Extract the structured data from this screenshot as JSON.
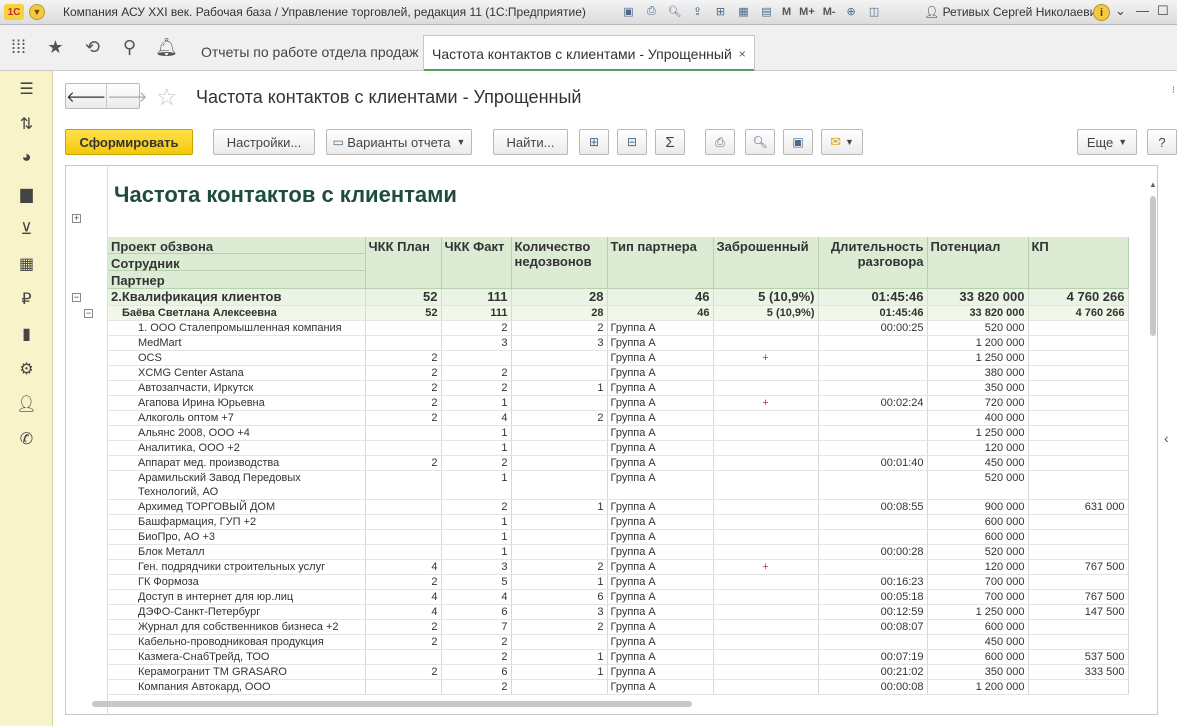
{
  "window": {
    "title": "Компания АСУ XXI век. Рабочая база / Управление торговлей, редакция 11  (1С:Предприятие)",
    "logo_text": "1С",
    "user": "Ретивых Сергей Николаевич",
    "memory_labels": [
      "M",
      "M+",
      "M-"
    ]
  },
  "tabs": [
    {
      "label": "Отчеты по работе отдела продаж",
      "close": "×"
    },
    {
      "label": "Частота контактов с клиентами - Упрощенный",
      "close": "×"
    }
  ],
  "page": {
    "title": "Частота контактов с клиентами - Упрощенный"
  },
  "toolbar": {
    "generate": "Сформировать",
    "settings": "Настройки...",
    "variants": "Варианты отчета",
    "find": "Найти...",
    "more": "Еще",
    "help": "?"
  },
  "report": {
    "title": "Частота контактов с клиентами",
    "headers": {
      "grouping": [
        "Проект обзвона",
        "Сотрудник",
        "Партнер"
      ],
      "columns": [
        "ЧКК План",
        "ЧКК Факт",
        "Количество недозвонов",
        "Тип партнера",
        "Заброшенный",
        "Длительность разговора",
        "Потенциал",
        "КП"
      ]
    },
    "group1": {
      "name": "2.Квалификация клиентов",
      "plan": "52",
      "fact": "111",
      "miss": "28",
      "type": "46",
      "aband": "5 (10,9%)",
      "dur": "01:45:46",
      "pot": "33 820 000",
      "kp": "4 760 266"
    },
    "group2": {
      "name": "Баёва Светлана Алексеевна",
      "plan": "52",
      "fact": "111",
      "miss": "28",
      "type": "46",
      "aband": "5 (10,9%)",
      "dur": "01:45:46",
      "pot": "33 820 000",
      "kp": "4 760 266"
    },
    "rows": [
      {
        "name": "1. ООО Сталепромышленная компания",
        "plan": "",
        "fact": "2",
        "miss": "2",
        "type": "Группа А",
        "aband": "",
        "dur": "00:00:25",
        "pot": "520 000",
        "kp": ""
      },
      {
        "name": "MedMart",
        "plan": "",
        "fact": "3",
        "miss": "3",
        "type": "Группа А",
        "aband": "",
        "dur": "",
        "pot": "1 200 000",
        "kp": ""
      },
      {
        "name": "OCS",
        "plan": "2",
        "fact": "",
        "miss": "",
        "type": "Группа А",
        "aband": "+",
        "dur": "",
        "pot": "1 250 000",
        "kp": ""
      },
      {
        "name": "XCMG Center Astana",
        "plan": "2",
        "fact": "2",
        "miss": "",
        "type": "Группа А",
        "aband": "",
        "dur": "",
        "pot": "380 000",
        "kp": ""
      },
      {
        "name": "Автозапчасти, Иркутск",
        "plan": "2",
        "fact": "2",
        "miss": "1",
        "type": "Группа А",
        "aband": "",
        "dur": "",
        "pot": "350 000",
        "kp": ""
      },
      {
        "name": "Агапова Ирина Юрьевна",
        "plan": "2",
        "fact": "1",
        "miss": "",
        "type": "Группа А",
        "aband": "+",
        "dur": "00:02:24",
        "pot": "720 000",
        "kp": ""
      },
      {
        "name": "Алкоголь оптом +7",
        "plan": "2",
        "fact": "4",
        "miss": "2",
        "type": "Группа А",
        "aband": "",
        "dur": "",
        "pot": "400 000",
        "kp": ""
      },
      {
        "name": "Альянс 2008, ООО +4",
        "plan": "",
        "fact": "1",
        "miss": "",
        "type": "Группа А",
        "aband": "",
        "dur": "",
        "pot": "1 250 000",
        "kp": ""
      },
      {
        "name": "Аналитика, ООО +2",
        "plan": "",
        "fact": "1",
        "miss": "",
        "type": "Группа А",
        "aband": "",
        "dur": "",
        "pot": "120 000",
        "kp": ""
      },
      {
        "name": "Аппарат мед. производства",
        "plan": "2",
        "fact": "2",
        "miss": "",
        "type": "Группа А",
        "aband": "",
        "dur": "00:01:40",
        "pot": "450 000",
        "kp": ""
      },
      {
        "name": "Арамильский Завод Передовых",
        "name2": "Технологий, АО",
        "plan": "",
        "fact": "1",
        "miss": "",
        "type": "Группа А",
        "aband": "",
        "dur": "",
        "pot": "520 000",
        "kp": ""
      },
      {
        "name": "Архимед ТОРГОВЫЙ ДОМ",
        "plan": "",
        "fact": "2",
        "miss": "1",
        "type": "Группа А",
        "aband": "",
        "dur": "00:08:55",
        "pot": "900 000",
        "kp": "631 000"
      },
      {
        "name": "Башфармация, ГУП +2",
        "plan": "",
        "fact": "1",
        "miss": "",
        "type": "Группа А",
        "aband": "",
        "dur": "",
        "pot": "600 000",
        "kp": ""
      },
      {
        "name": "БиоПро, АО +3",
        "plan": "",
        "fact": "1",
        "miss": "",
        "type": "Группа А",
        "aband": "",
        "dur": "",
        "pot": "600 000",
        "kp": ""
      },
      {
        "name": "Блок Металл",
        "plan": "",
        "fact": "1",
        "miss": "",
        "type": "Группа А",
        "aband": "",
        "dur": "00:00:28",
        "pot": "520 000",
        "kp": ""
      },
      {
        "name": "Ген. подрядчики строительных услуг",
        "plan": "4",
        "fact": "3",
        "miss": "2",
        "type": "Группа А",
        "aband": "+",
        "dur": "",
        "pot": "120 000",
        "kp": "767 500"
      },
      {
        "name": "ГК Формоза",
        "plan": "2",
        "fact": "5",
        "miss": "1",
        "type": "Группа А",
        "aband": "",
        "dur": "00:16:23",
        "pot": "700 000",
        "kp": ""
      },
      {
        "name": "Доступ в интернет для юр.лиц",
        "plan": "4",
        "fact": "4",
        "miss": "6",
        "type": "Группа А",
        "aband": "",
        "dur": "00:05:18",
        "pot": "700 000",
        "kp": "767 500"
      },
      {
        "name": "ДЭФО-Санкт-Петербург",
        "plan": "4",
        "fact": "6",
        "miss": "3",
        "type": "Группа А",
        "aband": "",
        "dur": "00:12:59",
        "pot": "1 250 000",
        "kp": "147 500"
      },
      {
        "name": "Журнал для собственников бизнеса +2",
        "plan": "2",
        "fact": "7",
        "miss": "2",
        "type": "Группа А",
        "aband": "",
        "dur": "00:08:07",
        "pot": "600 000",
        "kp": ""
      },
      {
        "name": "Кабельно-проводниковая продукция",
        "plan": "2",
        "fact": "2",
        "miss": "",
        "type": "Группа А",
        "aband": "",
        "dur": "",
        "pot": "450 000",
        "kp": ""
      },
      {
        "name": "Казмега-СнабТрейд, ТОО",
        "plan": "",
        "fact": "2",
        "miss": "1",
        "type": "Группа А",
        "aband": "",
        "dur": "00:07:19",
        "pot": "600 000",
        "kp": "537 500"
      },
      {
        "name": "Керамогранит ТМ GRASARO",
        "plan": "2",
        "fact": "6",
        "miss": "1",
        "type": "Группа А",
        "aband": "",
        "dur": "00:21:02",
        "pot": "350 000",
        "kp": "333 500"
      },
      {
        "name": "Компания Автокард, ООО",
        "plan": "",
        "fact": "2",
        "miss": "",
        "type": "Группа А",
        "aband": "",
        "dur": "00:00:08",
        "pot": "1 200 000",
        "kp": ""
      }
    ]
  }
}
